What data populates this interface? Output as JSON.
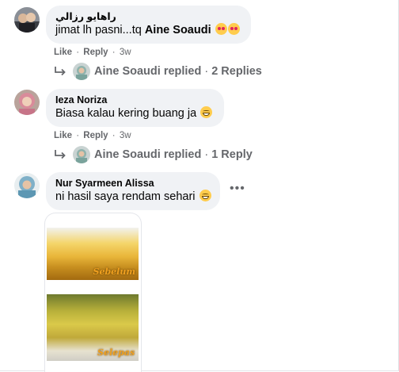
{
  "comments": [
    {
      "name": "راهايو رزالي",
      "text_parts": [
        "jimat lh pasni...tq ",
        "Aine Soaudi"
      ],
      "emoji": [
        "heart-eyes-emoji",
        "heart-eyes-emoji"
      ],
      "actions": {
        "like": "Like",
        "reply": "Reply",
        "time": "3w"
      },
      "replies_summary": {
        "author": "Aine Soaudi replied",
        "count": "2 Replies"
      }
    },
    {
      "name": "Ieza Noriza",
      "text": "Biasa kalau kering buang ja",
      "emoji": [
        "grinning-emoji"
      ],
      "actions": {
        "like": "Like",
        "reply": "Reply",
        "time": "3w"
      },
      "replies_summary": {
        "author": "Aine Soaudi replied",
        "count": "1 Reply"
      }
    },
    {
      "name": "Nur Syarmeen Alissa",
      "text": "ni hasil saya rendam sehari",
      "emoji": [
        "grinning-emoji"
      ],
      "more": "•••",
      "attachment": {
        "label_before": "Sebelum",
        "label_after": "Selepas"
      }
    }
  ],
  "separator": "·",
  "colors": {
    "bubble": "#f0f2f5",
    "meta_text": "#65676b",
    "text": "#050505"
  }
}
